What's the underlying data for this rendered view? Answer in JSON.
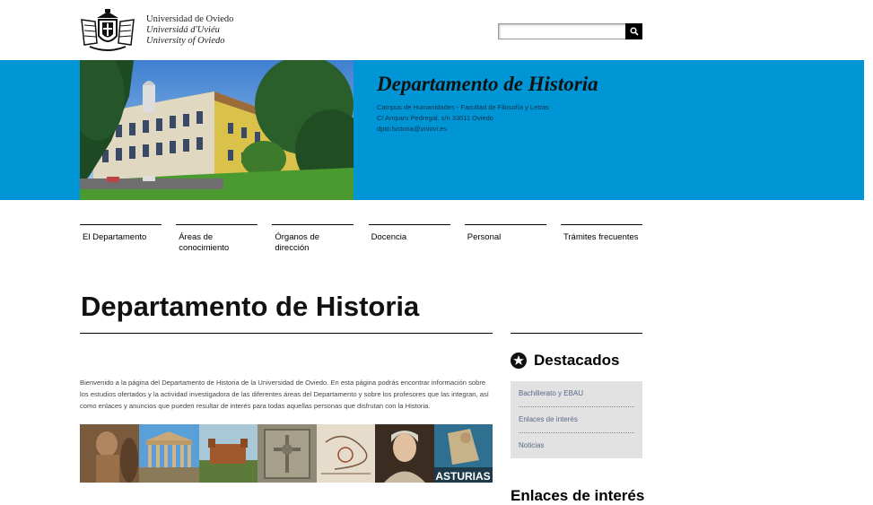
{
  "header": {
    "logo_line1": "Universidad de Oviedo",
    "logo_line2": "Universidá d'Uviéu",
    "logo_line3": "University of Oviedo"
  },
  "search": {
    "placeholder": "",
    "button_icon": "search-icon"
  },
  "banner": {
    "title": "Departamento de Historia",
    "address1": "Campus de Humanidades - Facultad de Filosofía y Letras",
    "address2": "C/ Amparo Pedregal, s/n 33011 Oviedo",
    "email": "dpto.historia@uniovi.es"
  },
  "nav": {
    "items": [
      {
        "label": "El Departamento"
      },
      {
        "label": "Áreas de conocimiento"
      },
      {
        "label": "Órganos de dirección"
      },
      {
        "label": "Docencia"
      },
      {
        "label": "Personal"
      },
      {
        "label": "Trámites frecuentes"
      }
    ]
  },
  "main": {
    "title": "Departamento de Historia",
    "intro": "Bienvenido a la página del Departamento de Historia de la Universidad de Oviedo. En esta página podrás encontrar información sobre los estudios ofertados y la actividad investigadora de las diferentes áreas del Departamento y sobre los profesores que las integran, así como enlaces y anuncios que pueden resultar de interés para todas aquellas personas que disfrutan con la Historia.",
    "strip_poster_text": "ASTURIAS"
  },
  "sidebar": {
    "destacados_title": "Destacados",
    "links": [
      {
        "label": "Bachillerato y EBAU"
      },
      {
        "label": "Enlaces de interés"
      },
      {
        "label": "Noticias"
      }
    ],
    "next_title": "Enlaces de interés"
  },
  "colors": {
    "banner_blue": "#0096d6",
    "sidebar_box": "#e2e2e2",
    "link": "#58688a"
  }
}
